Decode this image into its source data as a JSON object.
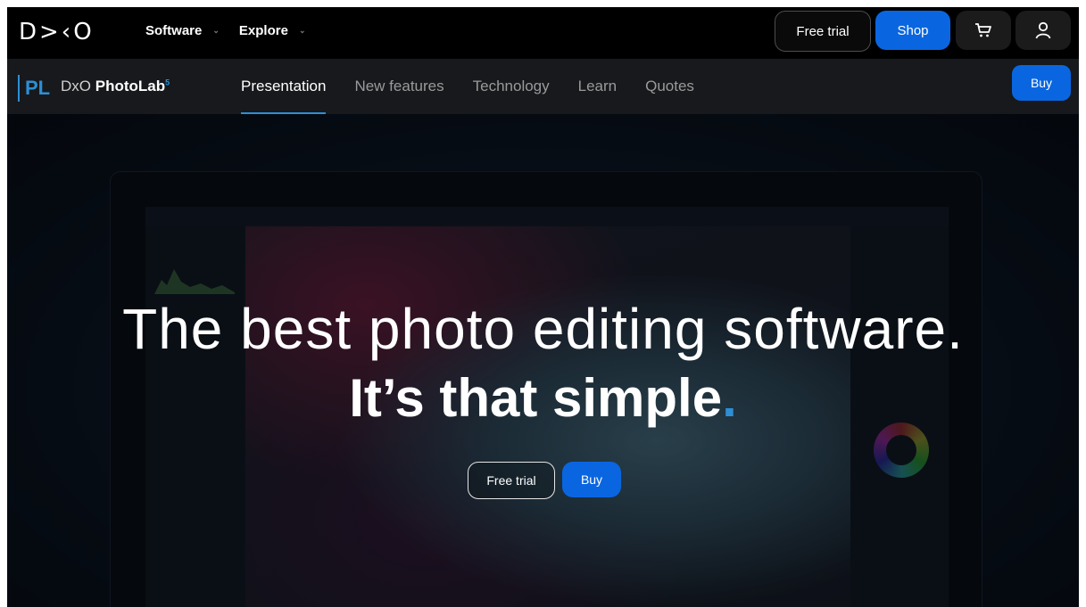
{
  "header": {
    "logo_text": "D>‹O",
    "nav": [
      {
        "label": "Software"
      },
      {
        "label": "Explore"
      }
    ],
    "free_trial_label": "Free trial",
    "shop_label": "Shop",
    "cart_icon": "cart-icon",
    "user_icon": "user-icon"
  },
  "product_bar": {
    "mark": "PL",
    "brand": "DxO",
    "name": "PhotoLab",
    "version": "5",
    "nav": [
      {
        "label": "Presentation",
        "active": true
      },
      {
        "label": "New features",
        "active": false
      },
      {
        "label": "Technology",
        "active": false
      },
      {
        "label": "Learn",
        "active": false
      },
      {
        "label": "Quotes",
        "active": false
      }
    ],
    "buy_label": "Buy"
  },
  "hero": {
    "headline": "The best photo editing software.",
    "subline": "It’s that simple",
    "subline_dot": ".",
    "free_trial_label": "Free trial",
    "buy_label": "Buy"
  },
  "colors": {
    "accent_blue": "#0a66e0",
    "brand_blue": "#2d8fd6",
    "background": "#000000",
    "product_bar": "#17191c"
  }
}
